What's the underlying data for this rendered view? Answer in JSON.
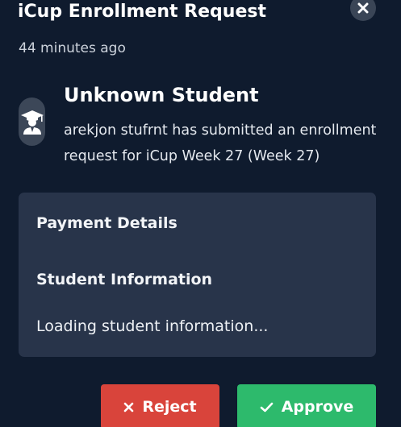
{
  "dialog": {
    "title": "iCup Enrollment Request",
    "timestamp": "44 minutes ago",
    "close_icon": "close-icon"
  },
  "request": {
    "avatar_icon": "graduation-cap-icon",
    "student_name": "Unknown Student",
    "message": "arekjon stufrnt has submitted an enrollment request for iCup Week 27 (Week 27)"
  },
  "details": {
    "payment_heading": "Payment Details",
    "student_heading": "Student Information",
    "loading_text": "Loading student information..."
  },
  "actions": {
    "reject_label": "Reject",
    "reject_icon": "x-icon",
    "reject_color": "#d9443b",
    "approve_label": "Approve",
    "approve_icon": "checkmark-icon",
    "approve_color": "#2dba6c"
  },
  "colors": {
    "background": "#0f1b2e",
    "panel": "#28344a"
  }
}
